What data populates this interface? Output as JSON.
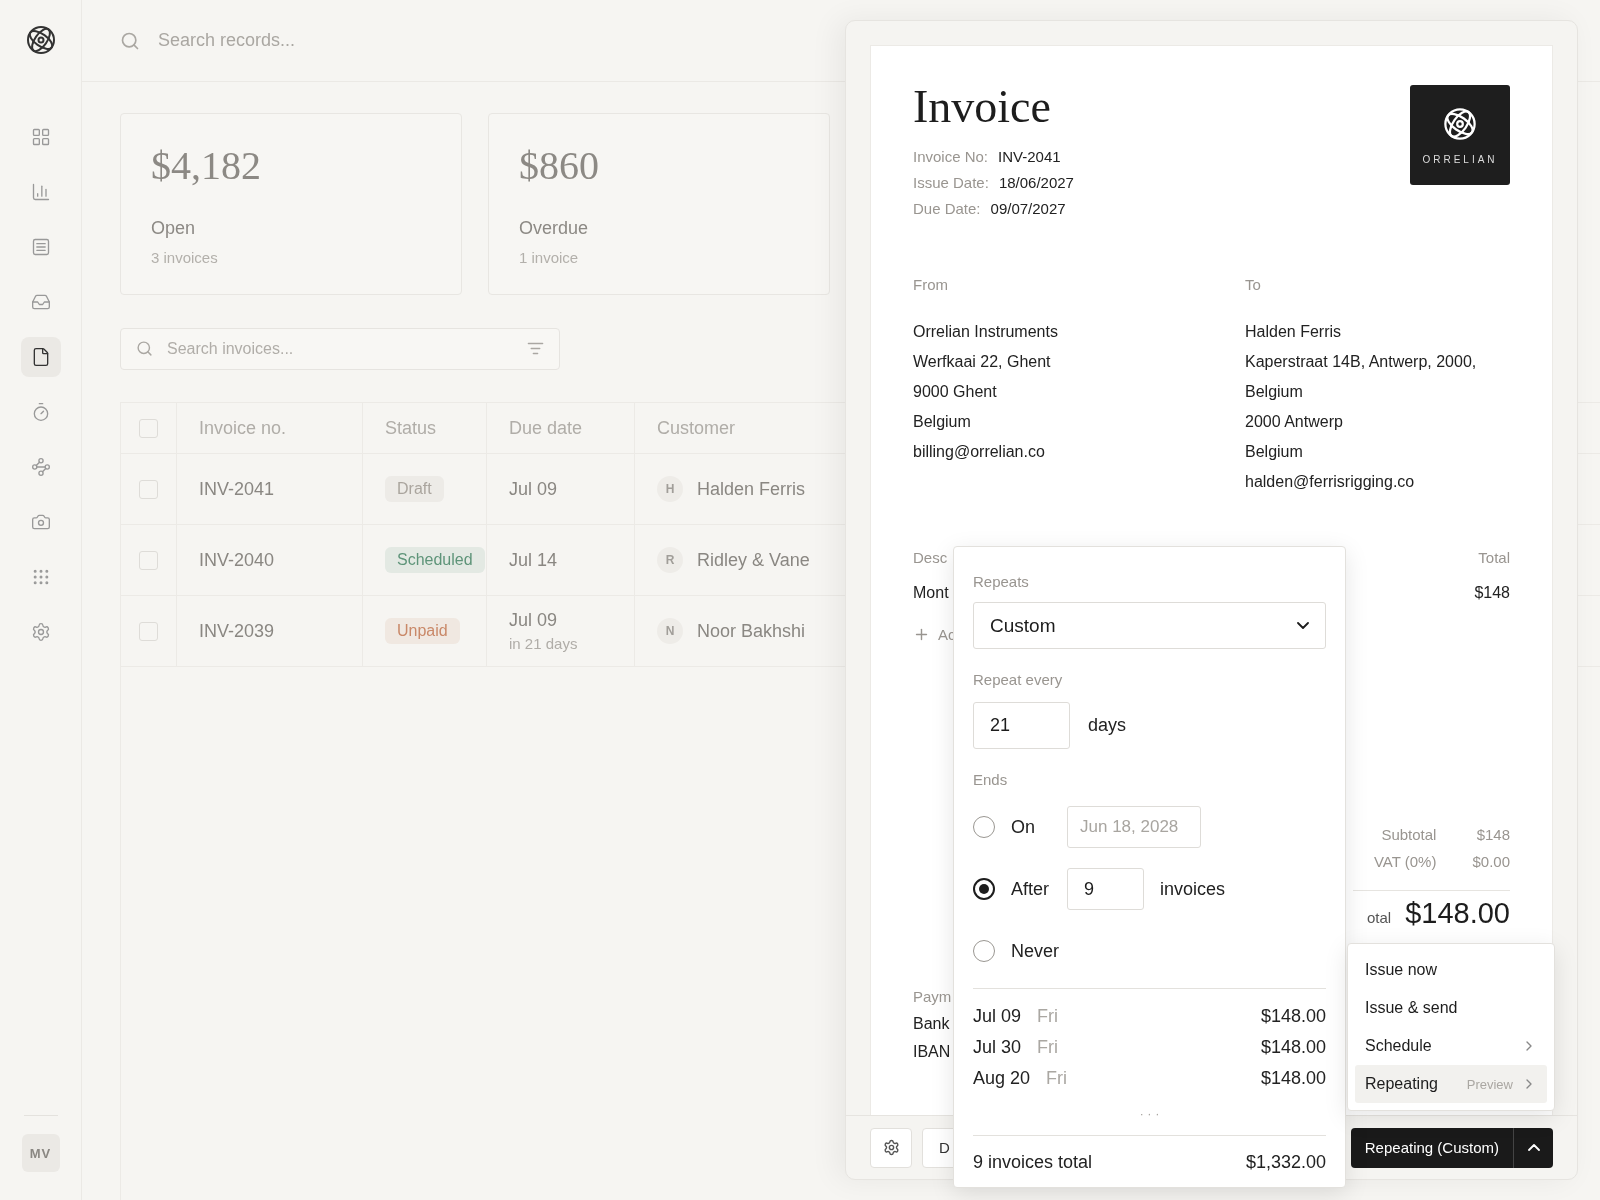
{
  "sidebar": {
    "items": [
      {
        "selected": false
      },
      {
        "selected": false
      },
      {
        "selected": false
      },
      {
        "selected": false
      },
      {
        "selected": true
      },
      {
        "selected": false
      },
      {
        "selected": false
      },
      {
        "selected": false
      },
      {
        "selected": false
      },
      {
        "selected": false
      }
    ],
    "user_initials": "MV"
  },
  "search": {
    "placeholder": "Search records..."
  },
  "summary_cards": [
    {
      "amount": "$4,182",
      "label": "Open",
      "count": "3 invoices"
    },
    {
      "amount": "$860",
      "label": "Overdue",
      "count": "1 invoice"
    }
  ],
  "invoice_search": {
    "placeholder": "Search invoices..."
  },
  "table": {
    "all_checked": false,
    "columns": [
      "Invoice no.",
      "Status",
      "Due date",
      "Customer"
    ],
    "rows": [
      {
        "checked": false,
        "invoice_no": "INV-2041",
        "status": "Draft",
        "color": "#aaa59e",
        "due_date": "Jul 09",
        "initial": "H",
        "customer": "Halden Ferris"
      },
      {
        "checked": false,
        "invoice_no": "INV-2040",
        "status": "Scheduled",
        "color": "#5e9479",
        "due_date": "Jul 14",
        "initial": "R",
        "customer": "Ridley & Vane"
      },
      {
        "checked": false,
        "invoice_no": "INV-2039",
        "status": "Unpaid",
        "color": "#c98868",
        "due_date": "Jul 09",
        "due_note": "in 21 days",
        "initial": "N",
        "customer": "Noor Bakhshi"
      }
    ]
  },
  "invoice": {
    "title": "Invoice",
    "logo_text": "ORRELIAN",
    "meta": [
      {
        "label": "Invoice No:",
        "value": "INV-2041"
      },
      {
        "label": "Issue Date:",
        "value": "18/06/2027"
      },
      {
        "label": "Due Date:",
        "value": "09/07/2027"
      }
    ],
    "from": {
      "label": "From",
      "lines": [
        "Orrelian Instruments",
        "Werfkaai 22, Ghent",
        "9000 Ghent",
        "Belgium",
        "billing@orrelian.co"
      ]
    },
    "to": {
      "label": "To",
      "lines": [
        "Halden Ferris",
        "Kaperstraat 14B, Antwerp, 2000,",
        "Belgium",
        "2000 Antwerp",
        "Belgium",
        "halden@ferrisrigging.co"
      ]
    },
    "items_header": {
      "description": "Desc",
      "total": "Total"
    },
    "items": [
      {
        "description": "Mont",
        "total": "$148"
      }
    ],
    "add_item": "Ac",
    "totals": [
      {
        "label": "Subtotal",
        "value": "$148"
      },
      {
        "label": "VAT (0%)",
        "value": "$0.00"
      }
    ],
    "grand_total": {
      "label": "otal",
      "value": "$148.00"
    },
    "payment": {
      "label": "Paym",
      "lines": [
        "Bank",
        "IBAN"
      ]
    }
  },
  "footer": {
    "secondary": "D",
    "primary": "Repeating (Custom)"
  },
  "repeat_popover": {
    "repeats_label": "Repeats",
    "repeats_value": "Custom",
    "every_label": "Repeat every",
    "every_value": "21",
    "every_unit": "days",
    "ends_label": "Ends",
    "ends_options": [
      {
        "kind": "date",
        "label": "On",
        "selected": false,
        "placeholder": "Jun 18, 2028"
      },
      {
        "kind": "count",
        "label": "After",
        "selected": true,
        "value": "9",
        "unit": "invoices"
      },
      {
        "kind": "plain",
        "label": "Never",
        "selected": false
      }
    ],
    "preview": [
      {
        "date": "Jul 09",
        "weekday": "Fri",
        "amount": "$148.00"
      },
      {
        "date": "Jul 30",
        "weekday": "Fri",
        "amount": "$148.00"
      },
      {
        "date": "Aug 20",
        "weekday": "Fri",
        "amount": "$148.00"
      }
    ],
    "more": "· · ·",
    "total_label": "9 invoices total",
    "total_value": "$1,332.00"
  },
  "action_menu": [
    {
      "label": "Issue now",
      "submenu": false,
      "selected": false
    },
    {
      "label": "Issue & send",
      "submenu": false,
      "selected": false
    },
    {
      "label": "Schedule",
      "submenu": true,
      "selected": false
    },
    {
      "label": "Repeating",
      "hint": "Preview",
      "submenu": true,
      "selected": true
    }
  ]
}
